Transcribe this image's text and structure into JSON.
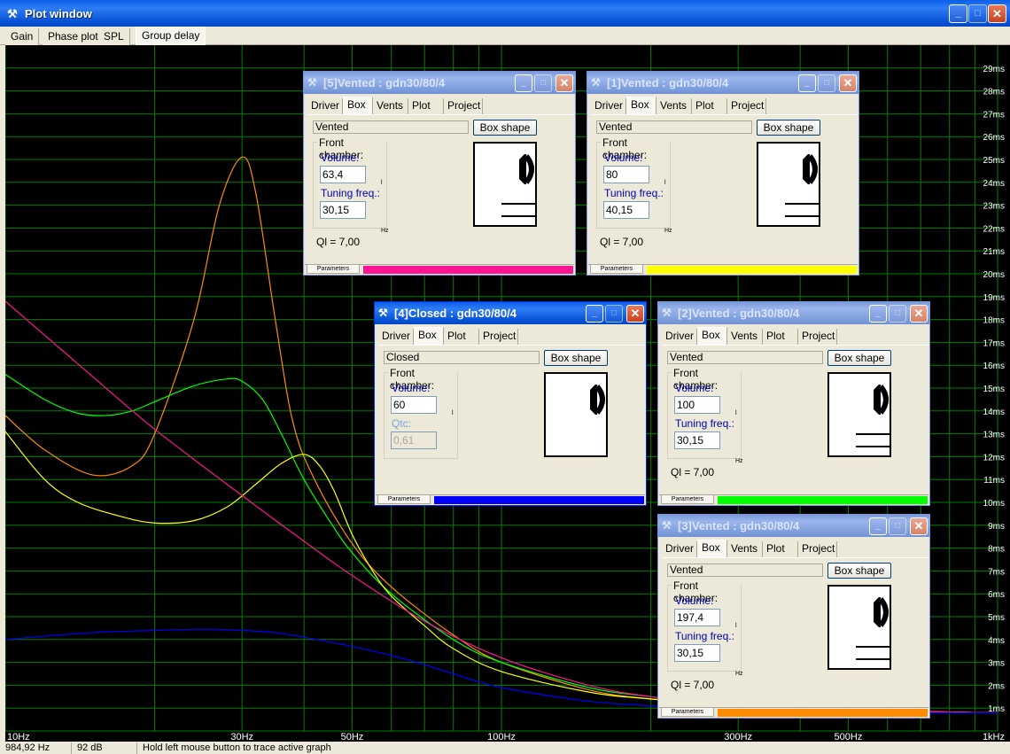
{
  "window": {
    "title": "Plot window",
    "controls": {
      "minimize": "_",
      "maximize": "□",
      "close": "✕"
    }
  },
  "main_tabs": [
    {
      "label": "Gain",
      "active": false
    },
    {
      "label": "Phase plot",
      "active": false
    },
    {
      "label": "SPL",
      "active": false
    },
    {
      "label": "Group delay",
      "active": true
    }
  ],
  "statusbar": {
    "frequency": "984,92 Hz",
    "level": "92 dB",
    "hint": "Hold left mouse button to trace active graph"
  },
  "chart_data": {
    "type": "line",
    "title": "",
    "xlabel": "",
    "ylabel": "",
    "x_scale": "log",
    "xlim": [
      10,
      1000
    ],
    "ylim": [
      0,
      30
    ],
    "grid": true,
    "background": "#000000",
    "grid_color": "#008000",
    "x_tick_labels": [
      {
        "value": 10,
        "label": "10Hz"
      },
      {
        "value": 30,
        "label": "30Hz"
      },
      {
        "value": 50,
        "label": "50Hz"
      },
      {
        "value": 100,
        "label": "100Hz"
      },
      {
        "value": 300,
        "label": "300Hz"
      },
      {
        "value": 500,
        "label": "500Hz"
      },
      {
        "value": 1000,
        "label": "1kHz"
      }
    ],
    "y_tick_labels": [
      {
        "value": 1,
        "label": "1ms"
      },
      {
        "value": 2,
        "label": "2ms"
      },
      {
        "value": 3,
        "label": "3ms"
      },
      {
        "value": 4,
        "label": "4ms"
      },
      {
        "value": 5,
        "label": "5ms"
      },
      {
        "value": 6,
        "label": "6ms"
      },
      {
        "value": 7,
        "label": "7ms"
      },
      {
        "value": 8,
        "label": "8ms"
      },
      {
        "value": 9,
        "label": "9ms"
      },
      {
        "value": 10,
        "label": "10ms"
      },
      {
        "value": 11,
        "label": "11ms"
      },
      {
        "value": 12,
        "label": "12ms"
      },
      {
        "value": 13,
        "label": "13ms"
      },
      {
        "value": 14,
        "label": "14ms"
      },
      {
        "value": 15,
        "label": "15ms"
      },
      {
        "value": 16,
        "label": "16ms"
      },
      {
        "value": 17,
        "label": "17ms"
      },
      {
        "value": 18,
        "label": "18ms"
      },
      {
        "value": 19,
        "label": "19ms"
      },
      {
        "value": 20,
        "label": "20ms"
      },
      {
        "value": 21,
        "label": "21ms"
      },
      {
        "value": 22,
        "label": "22ms"
      },
      {
        "value": 23,
        "label": "23ms"
      },
      {
        "value": 24,
        "label": "24ms"
      },
      {
        "value": 25,
        "label": "25ms"
      },
      {
        "value": 26,
        "label": "26ms"
      },
      {
        "value": 27,
        "label": "27ms"
      },
      {
        "value": 28,
        "label": "28ms"
      },
      {
        "value": 29,
        "label": "29ms"
      }
    ],
    "series": [
      {
        "color": "#ff8c00",
        "x": [
          10,
          12,
          15,
          18,
          20,
          24,
          27,
          30,
          32,
          35,
          38,
          42,
          50,
          60,
          80,
          100,
          150,
          200,
          300,
          500,
          1000
        ],
        "y": [
          13.8,
          12.3,
          11.2,
          11.6,
          13.0,
          18.0,
          23.0,
          25.1,
          23.5,
          18.0,
          13.5,
          11.0,
          8.2,
          6.3,
          4.2,
          3.0,
          1.8,
          1.4,
          1.1,
          0.9,
          0.8
        ]
      },
      {
        "color": "#00ff00",
        "x": [
          10,
          12,
          14,
          16,
          18,
          20,
          24,
          28,
          30,
          33,
          36,
          40,
          45,
          50,
          60,
          80,
          100,
          150,
          200,
          300,
          500,
          1000
        ],
        "y": [
          15.6,
          14.5,
          13.9,
          13.8,
          14.0,
          14.4,
          15.1,
          15.4,
          15.3,
          14.5,
          13.0,
          11.0,
          9.2,
          7.8,
          6.0,
          4.0,
          3.0,
          1.9,
          1.5,
          1.1,
          0.9,
          0.8
        ]
      },
      {
        "color": "#ffff00",
        "x": [
          10,
          12,
          14,
          17,
          20,
          24,
          28,
          32,
          36,
          40,
          43,
          46,
          50,
          55,
          60,
          70,
          80,
          100,
          150,
          200,
          300,
          500,
          1000
        ],
        "y": [
          13.1,
          11.0,
          10.0,
          9.4,
          9.1,
          9.2,
          9.8,
          10.8,
          11.7,
          12.1,
          11.6,
          10.5,
          8.6,
          7.0,
          5.9,
          4.6,
          3.6,
          2.6,
          1.7,
          1.4,
          1.1,
          0.9,
          0.8
        ]
      },
      {
        "color": "#ff1493",
        "x": [
          10,
          15,
          20,
          30,
          40,
          50,
          70,
          100,
          150,
          200,
          300,
          500,
          1000
        ],
        "y": [
          18.8,
          15.5,
          13.2,
          10.3,
          8.3,
          6.8,
          4.8,
          3.2,
          2.0,
          1.5,
          1.1,
          0.9,
          0.8
        ]
      },
      {
        "color": "#0000ff",
        "x": [
          10,
          15,
          20,
          25,
          30,
          35,
          40,
          50,
          60,
          70,
          80,
          100,
          150,
          200,
          300,
          500,
          1000
        ],
        "y": [
          4.0,
          4.3,
          4.4,
          4.45,
          4.4,
          4.3,
          4.1,
          3.7,
          3.3,
          2.9,
          2.5,
          1.9,
          1.3,
          1.1,
          0.9,
          0.8,
          0.8
        ]
      }
    ]
  },
  "subwindows": [
    {
      "id": "w5",
      "title": "[5]Vented : gdn30/80/4",
      "active": false,
      "box_type": "Vented",
      "tabs": [
        {
          "label": "Driver",
          "active": false
        },
        {
          "label": "Box",
          "active": true
        },
        {
          "label": "Vents",
          "active": false
        },
        {
          "label": "Plot",
          "active": false
        },
        {
          "label": "Project",
          "active": false
        }
      ],
      "box_shape_label": "Box shape",
      "group_label": "Front chamber:",
      "field1_label": "Volume:",
      "field1_value": "63,4",
      "field1_unit": "l",
      "field2_label": "Tuning freq.:",
      "field2_value": "30,15",
      "field2_unit": "Hz",
      "ql": "Ql = 7,00",
      "params_label": "Parameters",
      "color": "#ff1493"
    },
    {
      "id": "w1",
      "title": "[1]Vented : gdn30/80/4",
      "active": false,
      "box_type": "Vented",
      "tabs": [
        {
          "label": "Driver",
          "active": false
        },
        {
          "label": "Box",
          "active": true
        },
        {
          "label": "Vents",
          "active": false
        },
        {
          "label": "Plot",
          "active": false
        },
        {
          "label": "Project",
          "active": false
        }
      ],
      "box_shape_label": "Box shape",
      "group_label": "Front chamber:",
      "field1_label": "Volume:",
      "field1_value": "80",
      "field1_unit": "l",
      "field2_label": "Tuning freq.:",
      "field2_value": "40,15",
      "field2_unit": "Hz",
      "ql": "Ql = 7,00",
      "params_label": "Parameters",
      "color": "#ffff00"
    },
    {
      "id": "w4",
      "title": "[4]Closed : gdn30/80/4",
      "active": true,
      "box_type": "Closed",
      "tabs": [
        {
          "label": "Driver",
          "active": false
        },
        {
          "label": "Box",
          "active": true
        },
        {
          "label": "Plot",
          "active": false
        },
        {
          "label": "Project",
          "active": false
        }
      ],
      "box_shape_label": "Box shape",
      "group_label": "Front chamber:",
      "field1_label": "Volume:",
      "field1_value": "60",
      "field1_unit": "l",
      "field2_label": "Qtc:",
      "field2_value": "0,61",
      "field2_unit": "",
      "ql": "",
      "params_label": "Parameters",
      "color": "#0000ff"
    },
    {
      "id": "w2",
      "title": "[2]Vented : gdn30/80/4",
      "active": false,
      "box_type": "Vented",
      "tabs": [
        {
          "label": "Driver",
          "active": false
        },
        {
          "label": "Box",
          "active": true
        },
        {
          "label": "Vents",
          "active": false
        },
        {
          "label": "Plot",
          "active": false
        },
        {
          "label": "Project",
          "active": false
        }
      ],
      "box_shape_label": "Box shape",
      "group_label": "Front chamber:",
      "field1_label": "Volume:",
      "field1_value": "100",
      "field1_unit": "l",
      "field2_label": "Tuning freq.:",
      "field2_value": "30,15",
      "field2_unit": "Hz",
      "ql": "Ql = 7,00",
      "params_label": "Parameters",
      "color": "#00ff00"
    },
    {
      "id": "w3",
      "title": "[3]Vented : gdn30/80/4",
      "active": false,
      "box_type": "Vented",
      "tabs": [
        {
          "label": "Driver",
          "active": false
        },
        {
          "label": "Box",
          "active": true
        },
        {
          "label": "Vents",
          "active": false
        },
        {
          "label": "Plot",
          "active": false
        },
        {
          "label": "Project",
          "active": false
        }
      ],
      "box_shape_label": "Box shape",
      "group_label": "Front chamber:",
      "field1_label": "Volume:",
      "field1_value": "197,4",
      "field1_unit": "l",
      "field2_label": "Tuning freq.:",
      "field2_value": "30,15",
      "field2_unit": "Hz",
      "ql": "Ql = 7,00",
      "params_label": "Parameters",
      "color": "#ff8c00"
    }
  ]
}
